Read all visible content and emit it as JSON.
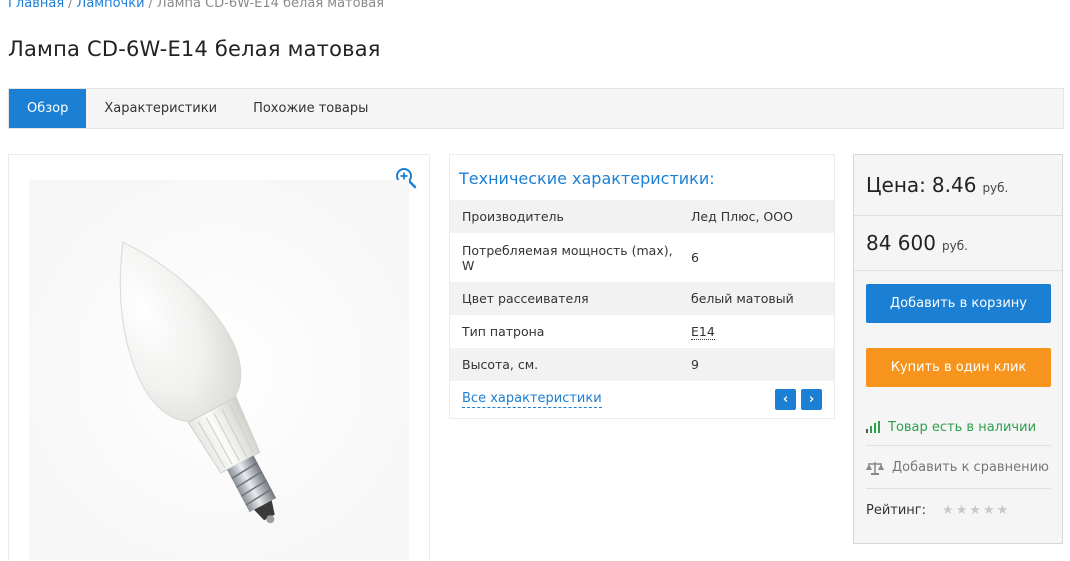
{
  "breadcrumb": {
    "home": "Главная",
    "category": "Лампочки",
    "current": "Лампа CD-6W-E14 белая матовая",
    "separator": "/"
  },
  "page_title": "Лампа CD-6W-E14 белая матовая",
  "tabs": [
    {
      "label": "Обзор",
      "active": true
    },
    {
      "label": "Характеристики",
      "active": false
    },
    {
      "label": "Похожие товары",
      "active": false
    }
  ],
  "image_panel": {
    "zoom_icon": "zoom-in-icon"
  },
  "specs": {
    "title": "Технические характеристики:",
    "rows": [
      {
        "name": "Производитель",
        "value": "Лед Плюс, ООО"
      },
      {
        "name": "Потребляемая мощность (max), W",
        "value": "6"
      },
      {
        "name": "Цвет рассеивателя",
        "value": "белый матовый"
      },
      {
        "name": "Тип патрона",
        "value": "E14"
      },
      {
        "name": "Высота, см.",
        "value": "9"
      }
    ],
    "all_link": "Все характеристики",
    "prev_arrow": "‹",
    "next_arrow": "›"
  },
  "buy": {
    "price_label": "Цена:",
    "price_value": "8.46",
    "price_currency": "руб.",
    "price2_value": "84 600",
    "price2_currency": "руб.",
    "add_to_cart": "Добавить в корзину",
    "one_click": "Купить в один клик",
    "availability": "Товар есть в наличии",
    "compare": "Добавить к сравнению",
    "rating_label": "Рейтинг:",
    "rating_value": 0,
    "rating_max": 5
  },
  "colors": {
    "accent": "#1b7fd4",
    "orange": "#f7941d",
    "in_stock": "#2e9f4e"
  }
}
